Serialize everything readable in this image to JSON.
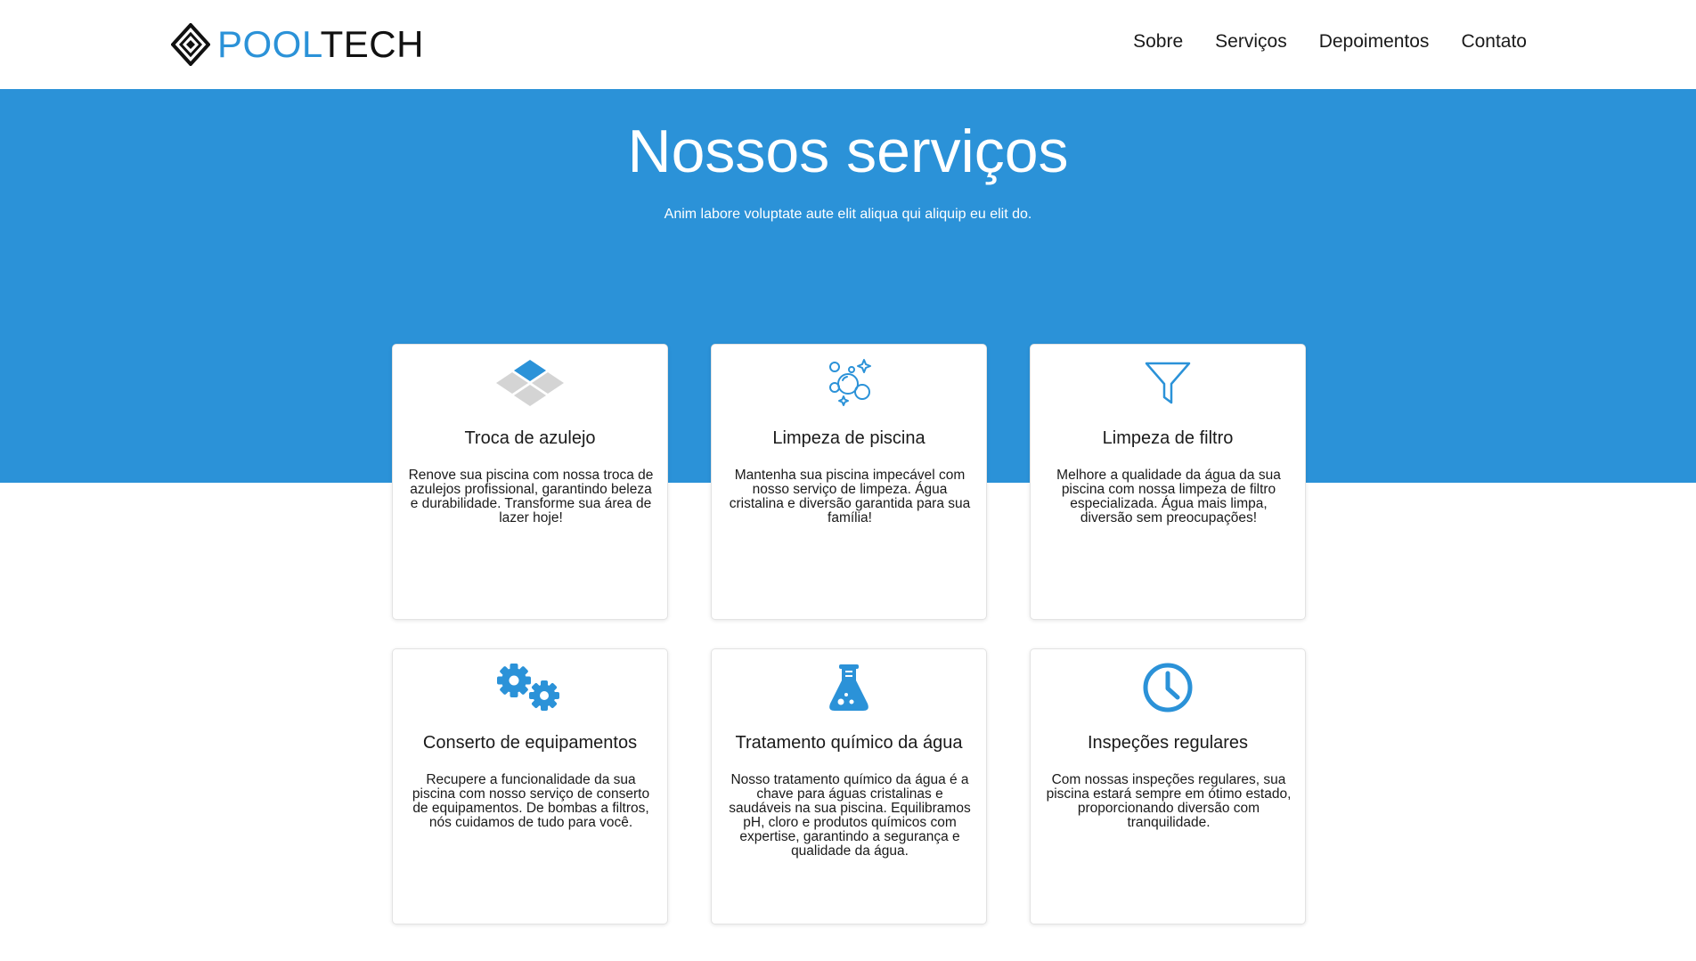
{
  "brand": {
    "pool": "POOL",
    "tech": "TECH",
    "accent": "#2b92d8"
  },
  "nav": {
    "items": [
      "Sobre",
      "Serviços",
      "Depoimentos",
      "Contato"
    ]
  },
  "hero": {
    "title": "Nossos serviços",
    "subtitle": "Anim labore voluptate aute elit aliqua qui aliquip eu elit do.",
    "background": "#2b92d8"
  },
  "services": [
    {
      "icon": "tiles-icon",
      "title": "Troca de azulejo",
      "description": "Renove sua piscina com nossa troca de azulejos profissional, garantindo beleza e durabilidade. Transforme sua área de lazer hoje!"
    },
    {
      "icon": "bubbles-icon",
      "title": "Limpeza de piscina",
      "description": "Mantenha sua piscina impecável com nosso serviço de limpeza. Água cristalina e diversão garantida para sua família!"
    },
    {
      "icon": "funnel-icon",
      "title": "Limpeza de filtro",
      "description": "Melhore a qualidade da água da sua piscina com nossa limpeza de filtro especializada. Água mais limpa, diversão sem preocupações!"
    },
    {
      "icon": "gears-icon",
      "title": "Conserto de equipamentos",
      "description": "Recupere a funcionalidade da sua piscina com nosso serviço de conserto de equipamentos. De bombas a filtros, nós cuidamos de tudo para você."
    },
    {
      "icon": "flask-icon",
      "title": "Tratamento químico da água",
      "description": "Nosso tratamento químico da água é a chave para águas cristalinas e saudáveis na sua piscina. Equilibramos pH, cloro e produtos químicos com expertise, garantindo a segurança e qualidade da água."
    },
    {
      "icon": "clock-icon",
      "title": "Inspeções regulares",
      "description": "Com nossas inspeções regulares, sua piscina estará sempre em ótimo estado, proporcionando diversão com tranquilidade."
    }
  ]
}
